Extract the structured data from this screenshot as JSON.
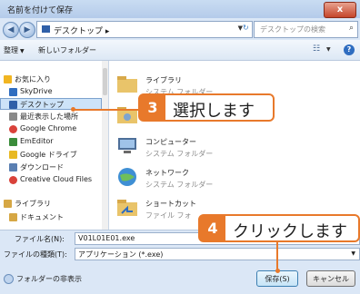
{
  "window": {
    "title": "名前を付けて保存",
    "close_label": "x"
  },
  "address": {
    "path": "デスクトップ ▸",
    "search_placeholder": "デスクトップの検索"
  },
  "commands": {
    "organize": "整理",
    "new_folder": "新しいフォルダー"
  },
  "nav": {
    "items": [
      {
        "label": "お気に入り",
        "icon": "star-icon",
        "color": "#f1b521"
      },
      {
        "label": "SkyDrive",
        "icon": "cloud-icon",
        "color": "#2f6dc0"
      },
      {
        "label": "デスクトップ",
        "icon": "desktop-icon",
        "color": "#2f5fa8",
        "selected": true
      },
      {
        "label": "最近表示した場所",
        "icon": "recent-icon",
        "color": "#8a8a8a"
      },
      {
        "label": "Google Chrome",
        "icon": "chrome-icon",
        "color": "#d9423a"
      },
      {
        "label": "EmEditor",
        "icon": "emeditor-icon",
        "color": "#3a8c3a"
      },
      {
        "label": "Google ドライブ",
        "icon": "drive-icon",
        "color": "#e8b923"
      },
      {
        "label": "ダウンロード",
        "icon": "download-icon",
        "color": "#5a7fb2"
      },
      {
        "label": "Creative Cloud Files",
        "icon": "creative-cloud-icon",
        "color": "#d9423a"
      },
      {
        "label": "ライブラリ",
        "icon": "library-icon",
        "color": "#d6a744"
      },
      {
        "label": "ドキュメント",
        "icon": "document-icon",
        "color": "#d6a744"
      }
    ]
  },
  "files": [
    {
      "name": "ライブラリ",
      "type": "システム フォルダー",
      "icon": "library-folder-icon"
    },
    {
      "name": "",
      "type": "",
      "icon": "user-folder-icon"
    },
    {
      "name": "コンピューター",
      "type": "システム フォルダー",
      "icon": "computer-icon"
    },
    {
      "name": "ネットワーク",
      "type": "システム フォルダー",
      "icon": "network-icon"
    },
    {
      "name": "ショートカット",
      "type": "ファイル フォ",
      "icon": "shortcut-icon"
    }
  ],
  "fields": {
    "filename_label": "ファイル名(N):",
    "filename_value": "V01L01E01.exe",
    "filetype_label": "ファイルの種類(T):",
    "filetype_value": "アプリケーション (*.exe)"
  },
  "footer": {
    "hide_folders": "フォルダーの非表示",
    "save": "保存(S)",
    "cancel": "キャンセル"
  },
  "callouts": {
    "step3": {
      "num": "3",
      "text": "選択します"
    },
    "step4": {
      "num": "4",
      "text": "クリックします"
    }
  },
  "colors": {
    "accent": "#e8792b",
    "selection": "#cde3f8"
  }
}
